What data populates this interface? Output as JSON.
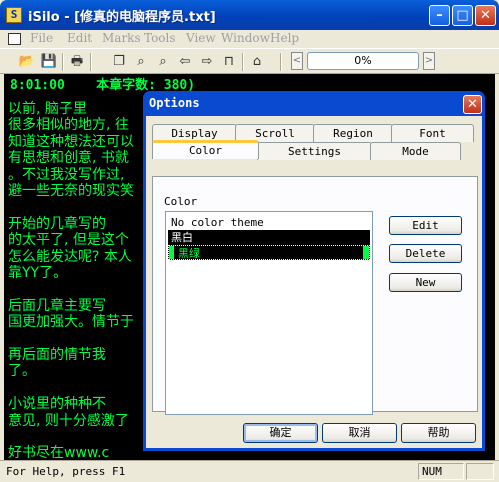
{
  "window": {
    "title": "iSilo - [修真的电脑程序员.txt]",
    "icon": "app-icon-isilo"
  },
  "menubar": {
    "items": [
      "File",
      "Edit",
      "Marks",
      "Tools",
      "View",
      "Window",
      "Help"
    ]
  },
  "toolbar": {
    "progress": "0%",
    "left_arrow": "<",
    "right_arrow": ">"
  },
  "reader": {
    "status_line": "8:01:00    本章字数: 380)",
    "lines": [
      "      以前, 脑子里",
      "很多相似的地方, 往",
      "知道这种想法还可以",
      "有思想和创意, 书就",
      "。不过我没写作过,",
      "避一些无奈的现实笑",
      "",
      "      开始的几章写的",
      "的太平了, 但是这个",
      "怎么能发达呢? 本人",
      "靠YY了。",
      "",
      "      后面几章主要写",
      "国更加强大。情节于",
      "",
      "      再后面的情节我",
      "了。",
      "",
      "      小说里的种种不",
      "意见, 则十分感激了",
      "",
      "      好书尽在www.c"
    ]
  },
  "status": {
    "text": "For Help, press F1",
    "num": "NUM"
  },
  "dialog": {
    "title": "Options",
    "tabs_back": [
      "Display",
      "Scroll",
      "Region",
      "Font"
    ],
    "tabs_front": [
      "Color",
      "Settings",
      "Mode"
    ],
    "active_tab": "Color",
    "group_label": "Color",
    "themes": [
      "No color theme",
      "黑白",
      "黑绿"
    ],
    "selected_theme": "黑绿",
    "buttons": {
      "edit": "Edit",
      "delete": "Delete",
      "new": "New"
    },
    "footer": {
      "ok": "确定",
      "cancel": "取消",
      "help": "帮助"
    }
  },
  "colors": {
    "reader_bg": "#000000",
    "reader_text": "#00ff40",
    "title_blue": "#0a4ad0",
    "tab_highlight": "#ffc83c"
  }
}
